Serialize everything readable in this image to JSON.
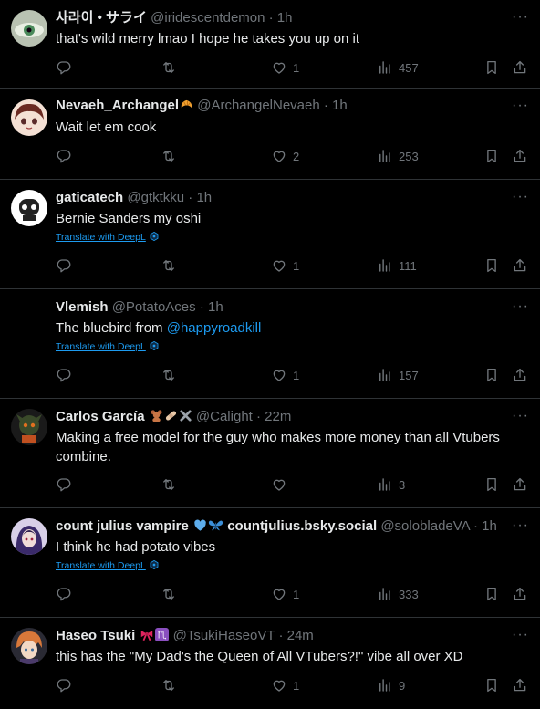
{
  "icons": {
    "reply": "reply-icon",
    "retweet": "retweet-icon",
    "like": "heart-icon",
    "views": "views-icon",
    "bookmark": "bookmark-icon",
    "share": "share-icon",
    "more": "more-icon",
    "deepl": "deepl-icon"
  },
  "colors": {
    "background": "#000000",
    "text": "#e7e9ea",
    "muted": "#71767b",
    "accent": "#1d9bf0",
    "divider": "#2f3336"
  },
  "more_label": "···",
  "tweets": [
    {
      "name": "사라이 • サライ",
      "handle": "@iridescentdemon",
      "time": "· 1h",
      "text": "that's wild merry lmao I hope he takes you up on it",
      "likes": "1",
      "views": "457"
    },
    {
      "name": "Nevaeh_Archangel",
      "handle": "@ArchangelNevaeh",
      "time": "· 1h",
      "text": "Wait let em cook",
      "likes": "2",
      "views": "253"
    },
    {
      "name": "gaticatech",
      "handle": "@gtktkku",
      "time": "· 1h",
      "text": "Bernie Sanders my oshi",
      "translate": "Translate with DeepL",
      "likes": "1",
      "views": "111"
    },
    {
      "name": "Vlemish",
      "handle": "@PotatoAces",
      "time": "· 1h",
      "text_before": "The bluebird from ",
      "mention": "@happyroadkill",
      "translate": "Translate with DeepL",
      "likes": "1",
      "views": "157"
    },
    {
      "name": "Carlos García",
      "handle": "@Calight",
      "time": "· 22m",
      "text": "Making a free model for the guy who makes more money than all Vtubers combine.",
      "likes": "",
      "views": "3"
    },
    {
      "name": "count julius vampire",
      "name2": "countjulius.bsky.social",
      "handle": "@solobladeVA",
      "time": "· 1h",
      "text": "I think he had potato vibes",
      "translate": "Translate with DeepL",
      "likes": "1",
      "views": "333"
    },
    {
      "name": "Haseo Tsuki",
      "handle": "@TsukiHaseoVT",
      "time": "· 24m",
      "text": "this has the \"My Dad's the Queen of All VTubers?!\" vibe all over XD",
      "likes": "1",
      "views": "9"
    }
  ]
}
